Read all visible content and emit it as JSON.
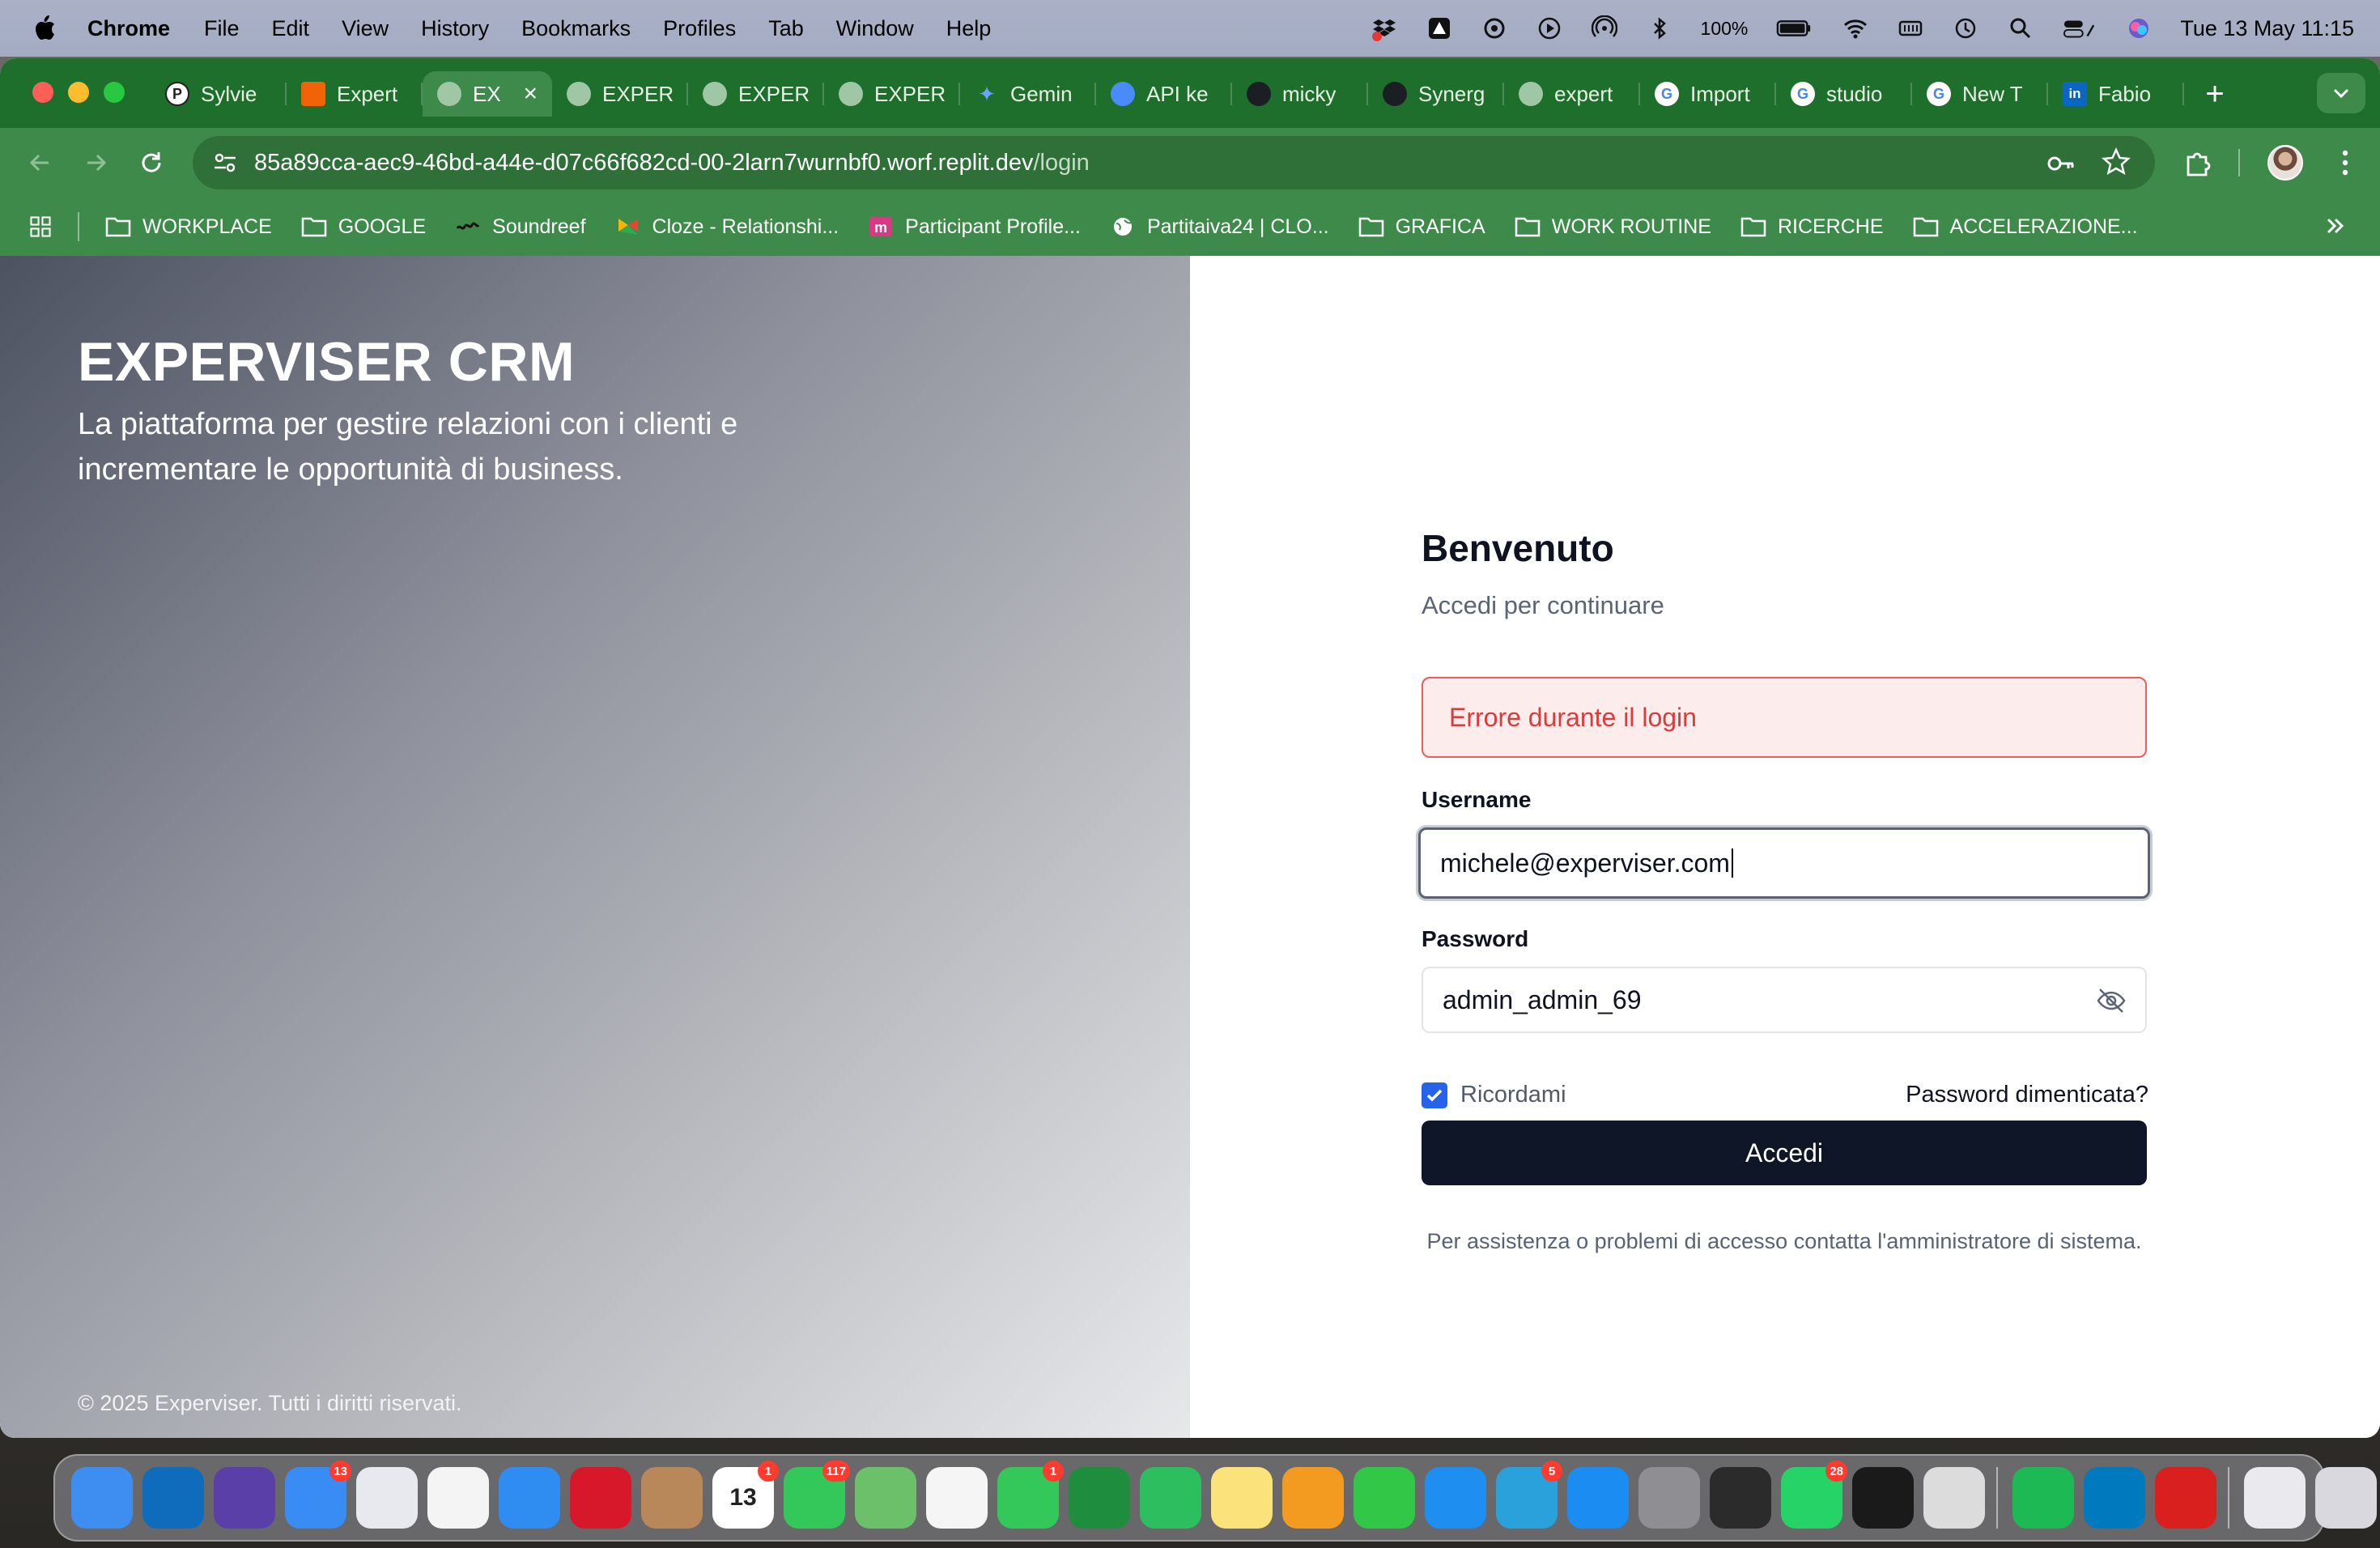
{
  "menubar": {
    "app_name": "Chrome",
    "items": [
      "File",
      "Edit",
      "View",
      "History",
      "Bookmarks",
      "Profiles",
      "Tab",
      "Window",
      "Help"
    ],
    "battery": "100%",
    "clock": "Tue 13 May  11:15"
  },
  "browser": {
    "tabs": [
      {
        "label": "Sylvie",
        "icon": "p-icon",
        "color": "#ffffff"
      },
      {
        "label": "Expert",
        "icon": "replit-icon",
        "color": "#f26207"
      },
      {
        "label": "EX",
        "icon": "globe-icon",
        "color": "#9fc7a6",
        "active": true
      },
      {
        "label": "EXPER",
        "icon": "globe-icon",
        "color": "#9fc7a6"
      },
      {
        "label": "EXPER",
        "icon": "globe-icon",
        "color": "#9fc7a6"
      },
      {
        "label": "EXPER",
        "icon": "globe-icon",
        "color": "#9fc7a6"
      },
      {
        "label": "Gemin",
        "icon": "gemini-icon",
        "color": "#6aa2ff"
      },
      {
        "label": "API ke",
        "icon": "api-icon",
        "color": "#4a8bfc"
      },
      {
        "label": "micky",
        "icon": "github-icon",
        "color": "#1b1f23"
      },
      {
        "label": "Synerg",
        "icon": "github-icon",
        "color": "#1b1f23"
      },
      {
        "label": "expert",
        "icon": "globe-icon",
        "color": "#9fc7a6"
      },
      {
        "label": "Import",
        "icon": "google-icon",
        "color": "#ffffff"
      },
      {
        "label": "studio",
        "icon": "google-icon",
        "color": "#ffffff"
      },
      {
        "label": "New T",
        "icon": "chrome-icon",
        "color": "#ffffff"
      },
      {
        "label": "Fabio",
        "icon": "linkedin-icon",
        "color": "#0a66c2"
      }
    ],
    "url_host": "85a89cca-aec9-46bd-a44e-d07c66f682cd-00-2larn7wurnbf0.worf.replit.dev",
    "url_path": "/login",
    "bookmarks": [
      {
        "label": "WORKPLACE",
        "icon": "folder-icon"
      },
      {
        "label": "GOOGLE",
        "icon": "folder-icon"
      },
      {
        "label": "Soundreef",
        "icon": "soundreef-icon"
      },
      {
        "label": "Cloze - Relationshi...",
        "icon": "cloze-icon"
      },
      {
        "label": "Participant Profile...",
        "icon": "m-icon"
      },
      {
        "label": "Partitaiva24 | CLO...",
        "icon": "globe-icon"
      },
      {
        "label": "GRAFICA",
        "icon": "folder-icon"
      },
      {
        "label": "WORK ROUTINE",
        "icon": "folder-icon"
      },
      {
        "label": "RICERCHE",
        "icon": "folder-icon"
      },
      {
        "label": "ACCELERAZIONE...",
        "icon": "folder-icon"
      }
    ]
  },
  "hero": {
    "brand": "EXPERVISER CRM",
    "tagline": "La piattaforma per gestire relazioni con i clienti e incrementare le opportunità di business.",
    "copyright": "© 2025 Experviser. Tutti i diritti riservati."
  },
  "login": {
    "title": "Benvenuto",
    "subtitle": "Accedi per continuare",
    "error": "Errore durante il login",
    "username_label": "Username",
    "username_value": "michele@experviser.com",
    "password_label": "Password",
    "password_value": "admin_admin_69",
    "remember_label": "Ricordami",
    "remember_checked": true,
    "forgot_label": "Password dimenticata?",
    "submit_label": "Accedi",
    "help_text": "Per assistenza o problemi di accesso contatta l'amministratore di sistema."
  },
  "dock": {
    "apps": [
      {
        "name": "finder",
        "color": "#3d8ef0",
        "badge": ""
      },
      {
        "name": "outlook",
        "color": "#0f6cbd",
        "badge": ""
      },
      {
        "name": "siri",
        "color": "#5b3fa8",
        "badge": ""
      },
      {
        "name": "mail",
        "color": "#3a8cf5",
        "badge": "13"
      },
      {
        "name": "launchpad",
        "color": "#e7e9ef",
        "badge": ""
      },
      {
        "name": "chrome",
        "color": "#f4f4f4",
        "badge": ""
      },
      {
        "name": "safari",
        "color": "#2f8cf0",
        "badge": ""
      },
      {
        "name": "opera",
        "color": "#d7182a",
        "badge": ""
      },
      {
        "name": "contacts",
        "color": "#b8875a",
        "badge": ""
      },
      {
        "name": "calendar",
        "color": "#ffffff",
        "badge": "1"
      },
      {
        "name": "messages",
        "color": "#34c759",
        "badge": "117"
      },
      {
        "name": "maps",
        "color": "#6cc06a",
        "badge": ""
      },
      {
        "name": "photos",
        "color": "#f5f5f5",
        "badge": ""
      },
      {
        "name": "facetime",
        "color": "#34c759",
        "badge": "1"
      },
      {
        "name": "chat",
        "color": "#1e8e3e",
        "badge": ""
      },
      {
        "name": "evernote",
        "color": "#2dbe60",
        "badge": ""
      },
      {
        "name": "notes",
        "color": "#fbe27a",
        "badge": ""
      },
      {
        "name": "pages",
        "color": "#f39a21",
        "badge": ""
      },
      {
        "name": "numbers",
        "color": "#33c748",
        "badge": ""
      },
      {
        "name": "keynote",
        "color": "#1f8ef1",
        "badge": ""
      },
      {
        "name": "telegram",
        "color": "#2aa1db",
        "badge": "5"
      },
      {
        "name": "app-store",
        "color": "#1b8cf2",
        "badge": ""
      },
      {
        "name": "settings",
        "color": "#8e8e93",
        "badge": ""
      },
      {
        "name": "phone",
        "color": "#2b2b2b",
        "badge": ""
      },
      {
        "name": "whatsapp",
        "color": "#25d366",
        "badge": "28"
      },
      {
        "name": "chatgpt",
        "color": "#1a1a1a",
        "badge": ""
      },
      {
        "name": "iphone-mirroring",
        "color": "#dcdcdc",
        "badge": ""
      },
      {
        "name": "spotify",
        "color": "#1db954",
        "badge": ""
      },
      {
        "name": "trello",
        "color": "#0079bf",
        "badge": ""
      },
      {
        "name": "acrobat",
        "color": "#d9201e",
        "badge": ""
      },
      {
        "name": "downloads",
        "color": "#e9e9ee",
        "badge": ""
      },
      {
        "name": "trash",
        "color": "#d8d8de",
        "badge": ""
      }
    ]
  }
}
